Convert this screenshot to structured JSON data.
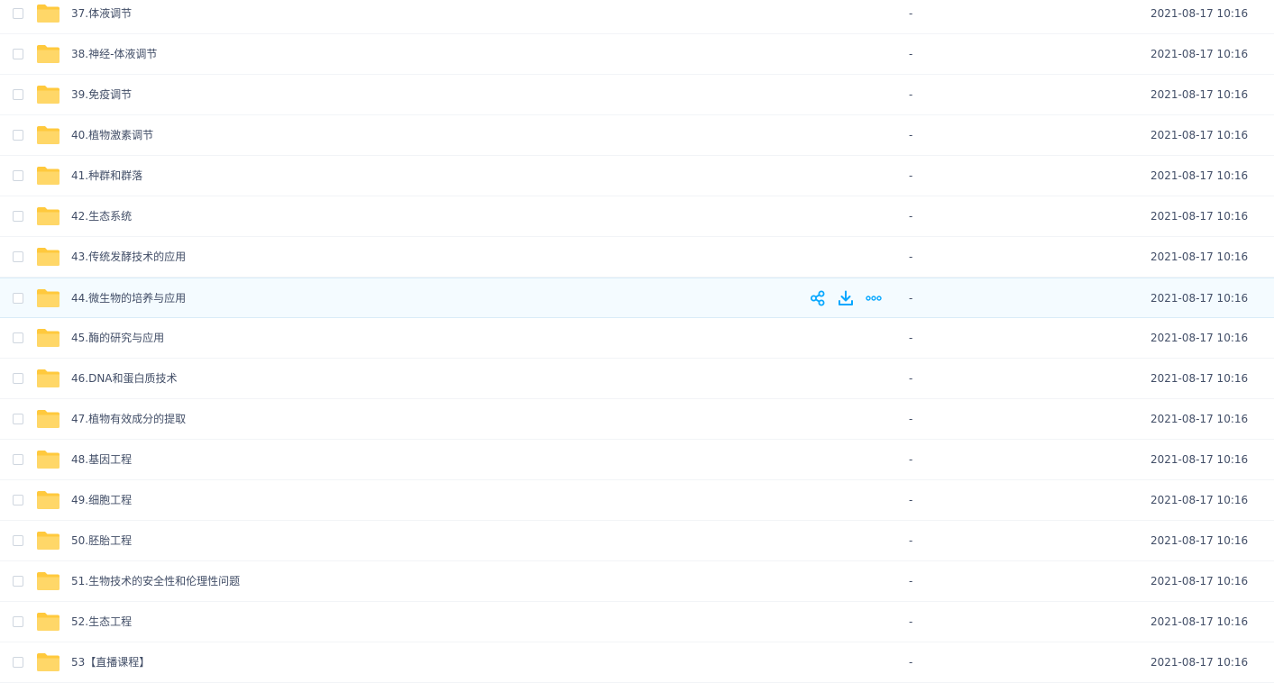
{
  "colors": {
    "folder": "#ffd768",
    "folder_tab": "#ffc93d",
    "accent": "#06a7ff",
    "text": "#424e67",
    "hover_bg": "#f4fbff"
  },
  "hover_actions": [
    {
      "icon": "share-icon"
    },
    {
      "icon": "download-icon"
    },
    {
      "icon": "more-icon"
    }
  ],
  "files": [
    {
      "name": "37.体液调节",
      "size": "-",
      "modified": "2021-08-17 10:16"
    },
    {
      "name": "38.神经-体液调节",
      "size": "-",
      "modified": "2021-08-17 10:16"
    },
    {
      "name": "39.免疫调节",
      "size": "-",
      "modified": "2021-08-17 10:16"
    },
    {
      "name": "40.植物激素调节",
      "size": "-",
      "modified": "2021-08-17 10:16"
    },
    {
      "name": "41.种群和群落",
      "size": "-",
      "modified": "2021-08-17 10:16"
    },
    {
      "name": "42.生态系统",
      "size": "-",
      "modified": "2021-08-17 10:16"
    },
    {
      "name": "43.传统发酵技术的应用",
      "size": "-",
      "modified": "2021-08-17 10:16"
    },
    {
      "name": "44.微生物的培养与应用",
      "size": "-",
      "modified": "2021-08-17 10:16"
    },
    {
      "name": "45.酶的研究与应用",
      "size": "-",
      "modified": "2021-08-17 10:16"
    },
    {
      "name": "46.DNA和蛋白质技术",
      "size": "-",
      "modified": "2021-08-17 10:16"
    },
    {
      "name": "47.植物有效成分的提取",
      "size": "-",
      "modified": "2021-08-17 10:16"
    },
    {
      "name": "48.基因工程",
      "size": "-",
      "modified": "2021-08-17 10:16"
    },
    {
      "name": "49.细胞工程",
      "size": "-",
      "modified": "2021-08-17 10:16"
    },
    {
      "name": "50.胚胎工程",
      "size": "-",
      "modified": "2021-08-17 10:16"
    },
    {
      "name": "51.生物技术的安全性和伦理性问题",
      "size": "-",
      "modified": "2021-08-17 10:16"
    },
    {
      "name": "52.生态工程",
      "size": "-",
      "modified": "2021-08-17 10:16"
    },
    {
      "name": "53【直播课程】",
      "size": "-",
      "modified": "2021-08-17 10:16"
    }
  ]
}
